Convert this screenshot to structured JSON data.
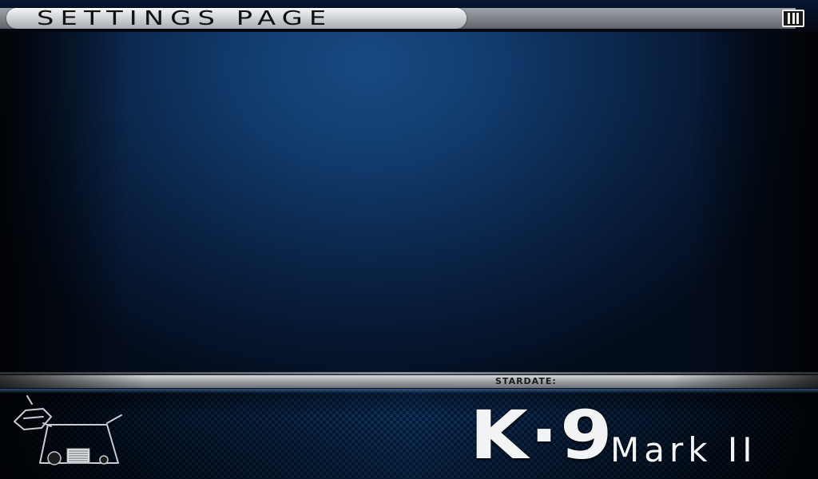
{
  "title_bar": {
    "title": "SETTINGS PAGE",
    "menu_icon": "menu-bars-icon"
  },
  "stardate": {
    "label": "STARDATE:",
    "value": ""
  },
  "brand": {
    "name": "K·9",
    "edition": "Mark II",
    "logo_icon": "robot-dog-icon"
  },
  "colors": {
    "background": "#0c2c57",
    "title_pill": "#d2d5d8",
    "accent_text": "#f2f3f5"
  }
}
